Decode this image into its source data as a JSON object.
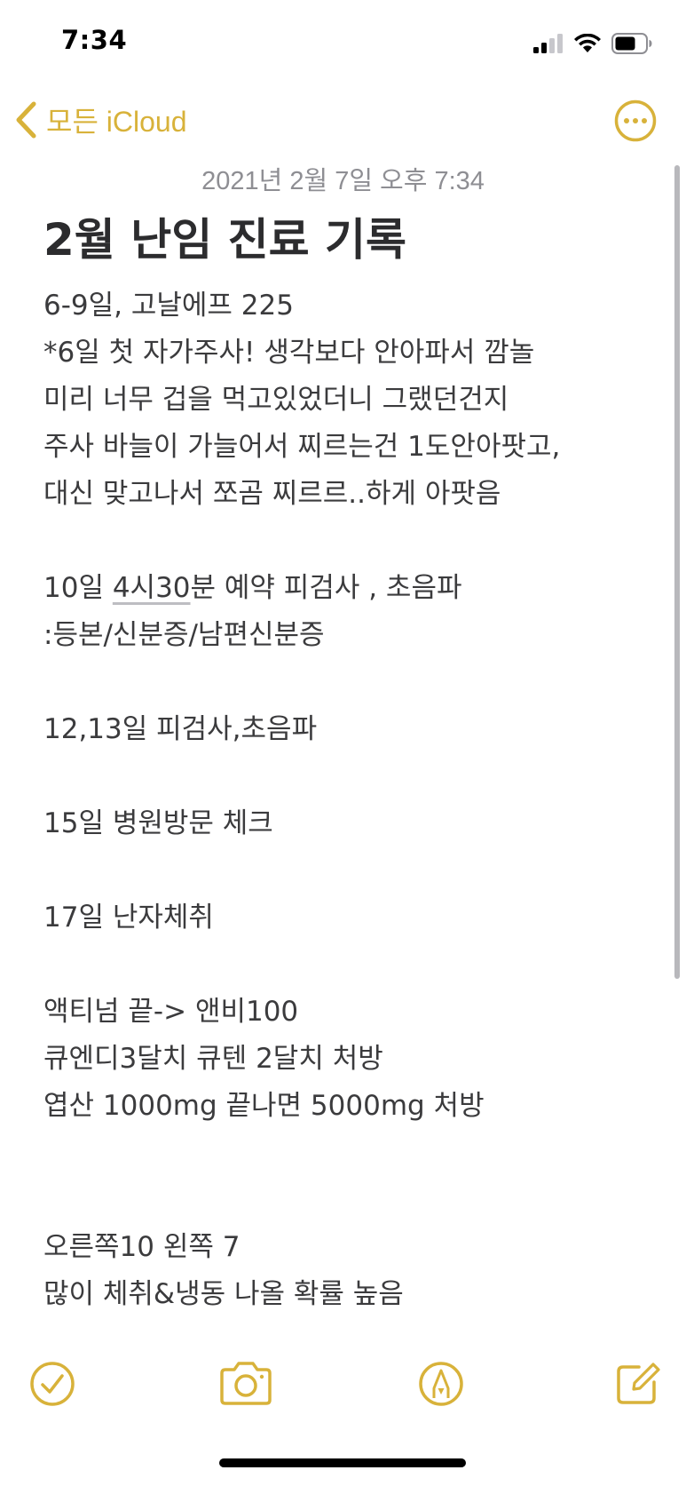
{
  "status_bar": {
    "time": "7:34"
  },
  "nav": {
    "back_label": "모든 iCloud"
  },
  "note": {
    "date": "2021년 2월 7일 오후 7:34",
    "title": "2월 난임 진료 기록",
    "lines": [
      "6-9일, 고날에프 225",
      "*6일 첫 자가주사! 생각보다 안아파서 깜놀",
      "미리 너무 겁을 먹고있었더니 그랬던건지",
      "주사 바늘이 가늘어서 찌르는건 1도안아팟고,",
      "대신 맞고나서 쪼곰 찌르르..하게 아팟음",
      "",
      "",
      ":등본/신분증/남편신분증",
      "",
      "12,13일 피검사,초음파",
      "",
      "15일 병원방문 체크",
      "",
      "17일 난자체취",
      "",
      "액티넘 끝-> 앤비100",
      "큐엔디3달치 큐텐 2달치 처방",
      "엽산 1000mg 끝나면 5000mg 처방",
      "",
      "",
      "오른쪽10 왼쪽 7",
      "많이 체취&냉동 나올 확률 높음"
    ],
    "line7": {
      "before": "10일 ",
      "link": "4시30",
      "after": "분 예약 피검사 , 초음파"
    }
  },
  "icons": {
    "accent_color": "#d8b23a",
    "back": "chevron-left-icon",
    "more": "ellipsis-circle-icon",
    "checklist": "checkmark-circle-icon",
    "camera": "camera-icon",
    "markup": "pen-circle-icon",
    "compose": "compose-icon"
  }
}
